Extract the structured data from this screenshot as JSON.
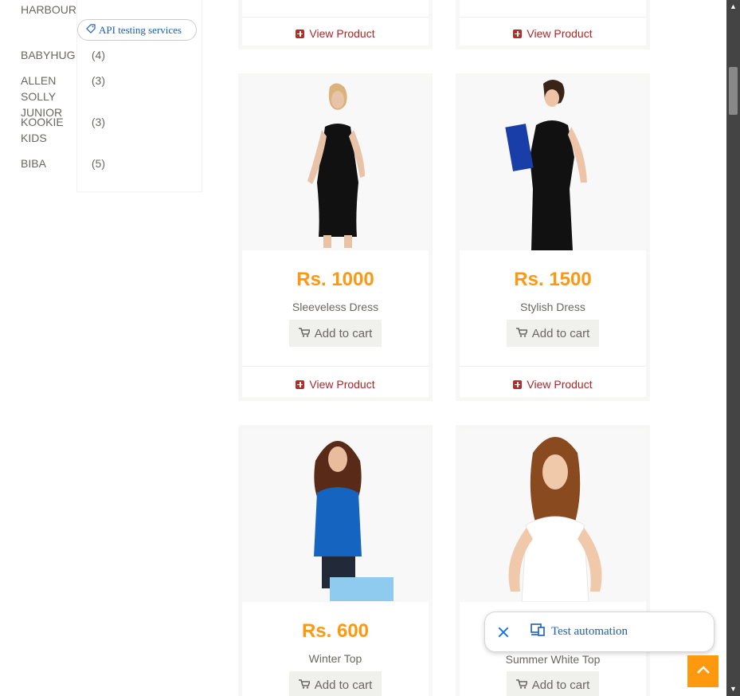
{
  "sidebar": {
    "brands": [
      {
        "name": "HARBOUR",
        "count": ""
      },
      {
        "name": "BABYHUG",
        "count": "(4)"
      },
      {
        "name": "ALLEN SOLLY JUNIOR",
        "count": "(3)"
      },
      {
        "name": "KOOKIE KIDS",
        "count": "(3)"
      },
      {
        "name": "BIBA",
        "count": "(5)"
      }
    ],
    "api_chip_label": "API testing services"
  },
  "products": [
    {
      "price": "",
      "name": "",
      "cart_label": "",
      "view_label": "View Product"
    },
    {
      "price": "",
      "name": "",
      "cart_label": "",
      "view_label": "View Product"
    },
    {
      "price": "Rs. 1000",
      "name": "Sleeveless Dress",
      "cart_label": "Add to cart",
      "view_label": "View Product"
    },
    {
      "price": "Rs. 1500",
      "name": "Stylish Dress",
      "cart_label": "Add to cart",
      "view_label": "View Product"
    },
    {
      "price": "Rs. 600",
      "name": "Winter Top",
      "cart_label": "Add to cart",
      "view_label": ""
    },
    {
      "price": "",
      "name": "Summer White Top",
      "cart_label": "Add to cart",
      "view_label": ""
    }
  ],
  "overlay": {
    "test_automation_label": "Test automation"
  },
  "colors": {
    "price": "#fe980f",
    "view_link": "#a52a2a",
    "chip_text": "#1a5fb4",
    "scroll_top_bg": "#fe980f"
  },
  "icons": [
    "tag-icon",
    "plus-square-icon",
    "shopping-cart-icon",
    "close-icon",
    "devices-icon",
    "chevron-up-icon"
  ]
}
